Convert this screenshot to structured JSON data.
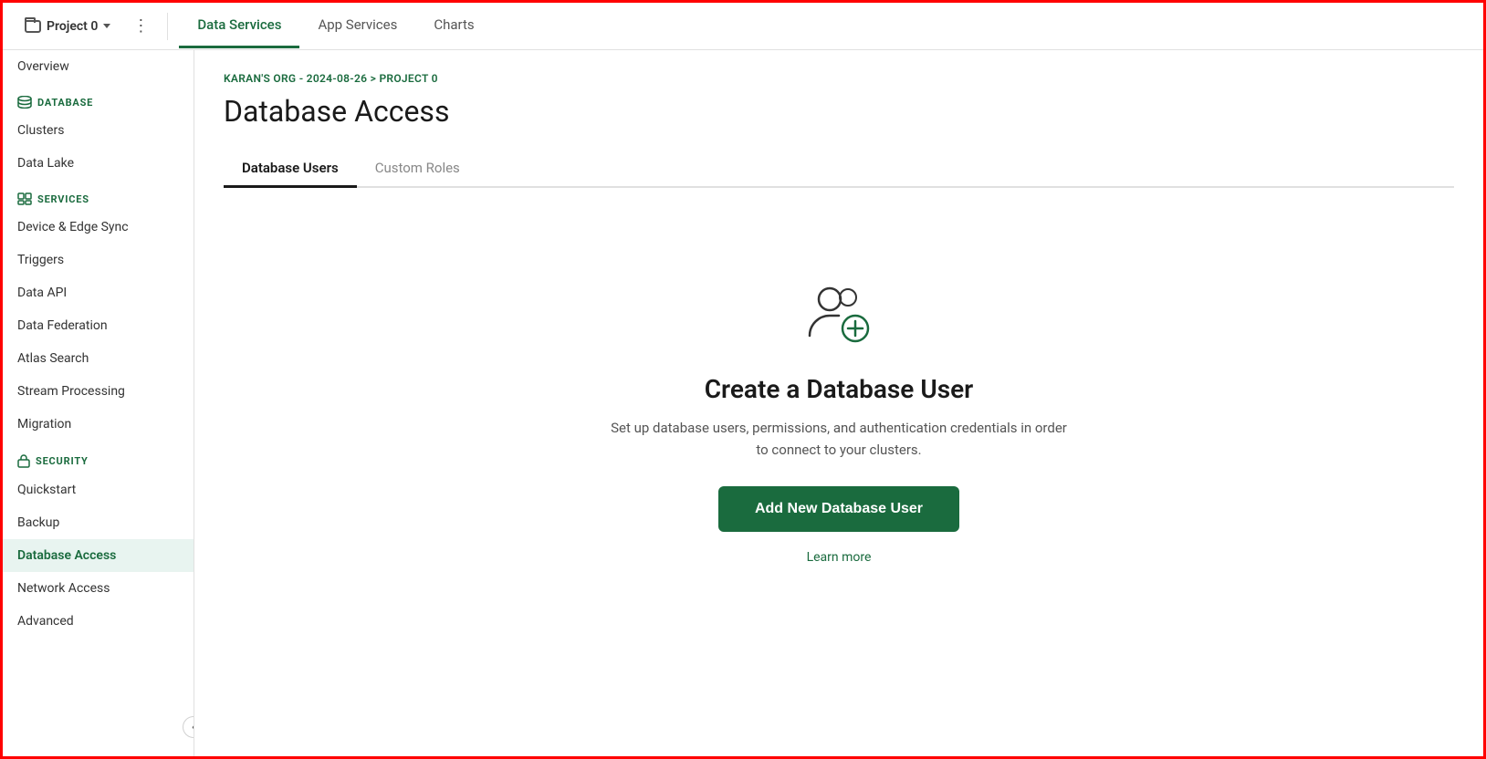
{
  "topNav": {
    "projectName": "Project 0",
    "tabs": [
      {
        "label": "Data Services",
        "active": true
      },
      {
        "label": "App Services",
        "active": false
      },
      {
        "label": "Charts",
        "active": false
      }
    ]
  },
  "sidebar": {
    "overview": "Overview",
    "sections": [
      {
        "label": "DATABASE",
        "iconType": "database",
        "items": [
          "Clusters",
          "Data Lake"
        ]
      },
      {
        "label": "SERVICES",
        "iconType": "services",
        "items": [
          "Device & Edge Sync",
          "Triggers",
          "Data API",
          "Data Federation",
          "Atlas Search",
          "Stream Processing",
          "Migration"
        ]
      },
      {
        "label": "SECURITY",
        "iconType": "lock",
        "items": [
          "Quickstart",
          "Backup",
          "Database Access",
          "Network Access",
          "Advanced"
        ]
      }
    ]
  },
  "breadcrumb": {
    "org": "KARAN'S ORG",
    "date": "2024-08-26",
    "project": "PROJECT 0",
    "separator": " > "
  },
  "page": {
    "title": "Database Access",
    "tabs": [
      {
        "label": "Database Users",
        "active": true
      },
      {
        "label": "Custom Roles",
        "active": false
      }
    ]
  },
  "emptyState": {
    "title": "Create a Database User",
    "description": "Set up database users, permissions, and authentication credentials in order to connect to your clusters.",
    "addButtonLabel": "Add New Database User",
    "learnMoreLabel": "Learn more"
  }
}
